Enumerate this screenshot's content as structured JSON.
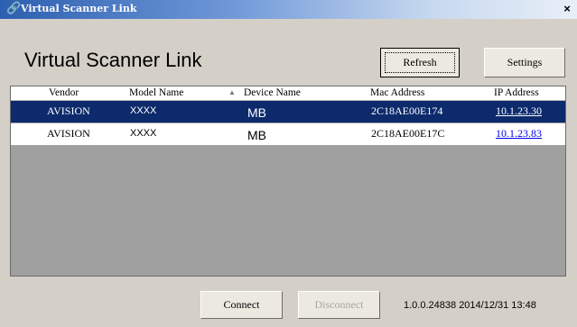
{
  "window": {
    "title": "Virtual Scanner Link",
    "close_glyph": "×",
    "title_icon": "link-icon"
  },
  "header": {
    "title": "Virtual Scanner Link"
  },
  "toolbar": {
    "refresh_label": "Refresh",
    "settings_label": "Settings"
  },
  "table": {
    "columns": [
      "Vendor",
      "Model Name",
      "Device Name",
      "Mac Address",
      "IP Address"
    ],
    "sort_indicator": "▲",
    "rows": [
      {
        "vendor": "AVISION",
        "model": "XXXX",
        "device": "MB",
        "mac": "2C18AE00E174",
        "ip": "10.1.23.30"
      },
      {
        "vendor": "AVISION",
        "model": "XXXX",
        "device": "MB",
        "mac": "2C18AE00E17C",
        "ip": "10.1.23.83"
      }
    ]
  },
  "footer": {
    "connect_label": "Connect",
    "disconnect_label": "Disconnect",
    "version": "1.0.0.24838",
    "datetime": "2014/12/31 13:48"
  },
  "colors": {
    "selected_row": "#0c2a6c",
    "link": "#0000ee",
    "title_gradient_start": "#2d5fb0"
  }
}
